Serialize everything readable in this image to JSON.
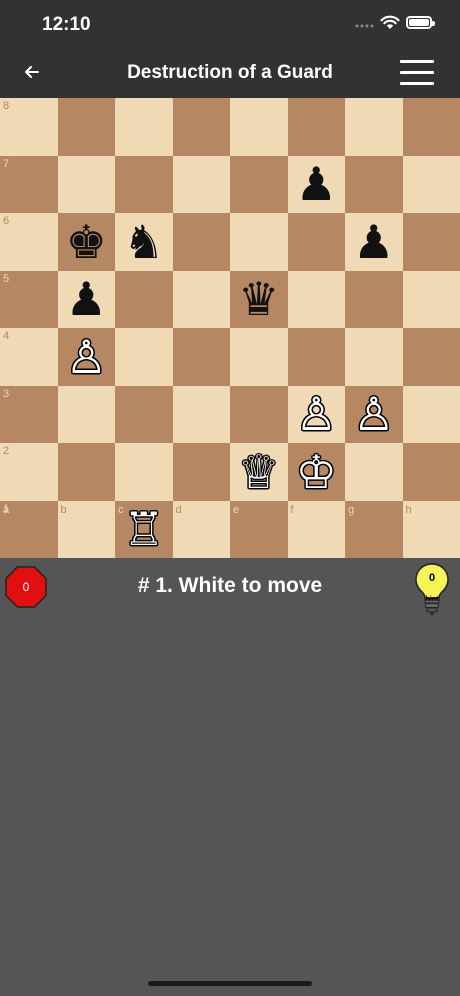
{
  "status": {
    "time": "12:10"
  },
  "nav": {
    "back_icon": "arrow-left-icon",
    "title": "Destruction of a Guard",
    "menu_icon": "hamburger-menu-icon"
  },
  "board": {
    "ranks": [
      "8",
      "7",
      "6",
      "5",
      "4",
      "3",
      "2",
      "1"
    ],
    "files": [
      "a",
      "b",
      "c",
      "d",
      "e",
      "f",
      "g",
      "h"
    ],
    "colors": {
      "light": "#f0d9b5",
      "dark": "#b58863"
    },
    "pieces": [
      {
        "square": "f7",
        "type": "pawn",
        "color": "black"
      },
      {
        "square": "b6",
        "type": "king",
        "color": "black"
      },
      {
        "square": "c6",
        "type": "knight",
        "color": "black"
      },
      {
        "square": "g6",
        "type": "pawn",
        "color": "black"
      },
      {
        "square": "b5",
        "type": "pawn",
        "color": "black"
      },
      {
        "square": "e5",
        "type": "queen",
        "color": "black"
      },
      {
        "square": "b4",
        "type": "pawn",
        "color": "white"
      },
      {
        "square": "f3",
        "type": "pawn",
        "color": "white"
      },
      {
        "square": "g3",
        "type": "pawn",
        "color": "white"
      },
      {
        "square": "e2",
        "type": "queen",
        "color": "white"
      },
      {
        "square": "f2",
        "type": "king",
        "color": "white"
      },
      {
        "square": "c1",
        "type": "rook",
        "color": "white"
      }
    ]
  },
  "info": {
    "mistakes_count": "0",
    "stop_color": "#e01010",
    "prompt": "# 1. White to move",
    "hint_count": "0",
    "hint_label": "hint",
    "hint_color": "#f5f55a"
  }
}
